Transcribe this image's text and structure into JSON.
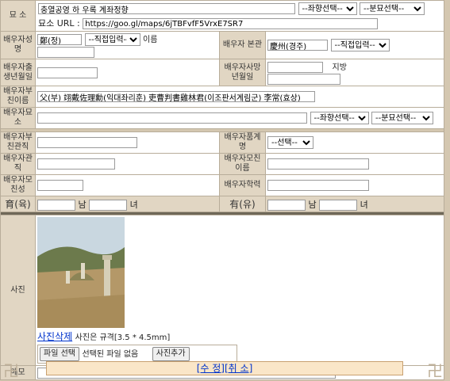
{
  "grave_location": {
    "label": "묘   소",
    "address_value": "충열공영 하 우록 계좌정향",
    "direction_select": "--좌향선택--",
    "burial_select": "--분묘선택--",
    "url_label": "묘소 URL :",
    "url_value": "https://goo.gl/maps/6jTBFvfF5VrxE7SR7"
  },
  "spouse_name": {
    "label": "배우자성명",
    "value": "鄭(정)",
    "input_select": "--직접입력--",
    "suffix": "이름"
  },
  "spouse_origin": {
    "label": "배우자 본관",
    "value": "慶州(경주)",
    "input_select": "--직접입력--"
  },
  "spouse_birth": {
    "label": "배우자출생년월일",
    "value": ""
  },
  "spouse_death": {
    "label": "배우자사망년월일",
    "value": "",
    "suffix": "지방"
  },
  "spouse_father": {
    "label": "배우자부친이름",
    "value": "父(부) 翊戴佐理勳(익대좌리훈) 吏曹判書雞林君(이조판서계림군) 李常(효상)"
  },
  "spouse_grave": {
    "label": "배우자묘소",
    "value": "",
    "direction_select": "--좌향선택--",
    "burial_select": "--분묘선택--"
  },
  "spouse_father_office": {
    "label": "배우자부친관직",
    "value": ""
  },
  "spouse_title": {
    "label": "배우자품계명",
    "select": "--선택--"
  },
  "spouse_office": {
    "label": "배우자관직",
    "value": ""
  },
  "spouse_mother_name": {
    "label": "배우자모친이름",
    "value": ""
  },
  "spouse_mother_clan": {
    "label": "배우자모친성",
    "value": ""
  },
  "spouse_education": {
    "label": "배우자학력",
    "value": ""
  },
  "children_raised": {
    "label": "育(육)",
    "son_unit": "남",
    "daughter_unit": "녀"
  },
  "children_present": {
    "label": "有(유)",
    "son_unit": "남",
    "daughter_unit": "녀"
  },
  "photo": {
    "label": "사진",
    "delete_link": "사진삭제",
    "spec_text": "사진은 규격[3.5 * 4.5mm]",
    "file_button": "파일 선택",
    "no_file_text": "선택된 파일 없음",
    "add_button": "사진추가"
  },
  "memo": {
    "label": "메모",
    "value": ""
  },
  "actions": {
    "save": "[수 정]",
    "cancel": "[취 소]"
  },
  "colors": {
    "label_bg": "#e1d6c3",
    "link": "#0033cc",
    "action_bar_bg": "#fae6c8"
  }
}
